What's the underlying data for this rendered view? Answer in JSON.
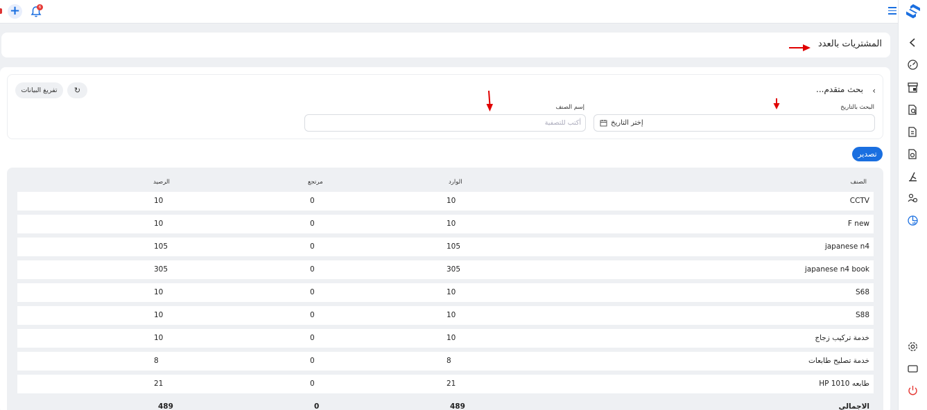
{
  "topbar": {
    "notification_count": "6",
    "icons": [
      "plus-icon",
      "bell-icon",
      "menu-icon"
    ]
  },
  "sidebar": {
    "icons": [
      "chevron-left-icon",
      "dashboard-icon",
      "store-icon",
      "search-doc-icon",
      "invoice-icon",
      "document-icon",
      "tools-icon",
      "users-icon",
      "reports-icon",
      "settings-icon",
      "window-icon",
      "power-icon"
    ]
  },
  "page": {
    "title": "المشتريات بالعدد"
  },
  "filters": {
    "advanced_search": "بحث متقدم...",
    "date_label": "البحث بالتاريخ",
    "date_placeholder": "إختر التاريخ",
    "item_label": "إسم الصنف",
    "item_placeholder": "أكتب للتصفية",
    "clear_button": "تفريغ البيانات",
    "export_button": "تصدير"
  },
  "table": {
    "headers": {
      "name": "الصنف",
      "in": "الوارد",
      "returned": "مرتجع",
      "balance": "الرصيد"
    },
    "rows": [
      {
        "name": "CCTV",
        "in": "10",
        "returned": "0",
        "balance": "10"
      },
      {
        "name": "F new",
        "in": "10",
        "returned": "0",
        "balance": "10"
      },
      {
        "name": "japanese n4",
        "in": "105",
        "returned": "0",
        "balance": "105"
      },
      {
        "name": "japanese n4 book",
        "in": "305",
        "returned": "0",
        "balance": "305"
      },
      {
        "name": "S68",
        "in": "10",
        "returned": "0",
        "balance": "10"
      },
      {
        "name": "S88",
        "in": "10",
        "returned": "0",
        "balance": "10"
      },
      {
        "name": "خدمة تركيب زجاج",
        "in": "10",
        "returned": "0",
        "balance": "10"
      },
      {
        "name": "خدمة تصليح طابعات",
        "in": "8",
        "returned": "0",
        "balance": "8"
      },
      {
        "name": "طابعه HP 1010",
        "in": "21",
        "returned": "0",
        "balance": "21"
      }
    ],
    "total": {
      "name": "الاجمالي",
      "in": "489",
      "returned": "0",
      "balance": "489"
    }
  },
  "colors": {
    "accent": "#1a6fe0",
    "annotation": "#e00000",
    "background": "#eef0f3"
  }
}
